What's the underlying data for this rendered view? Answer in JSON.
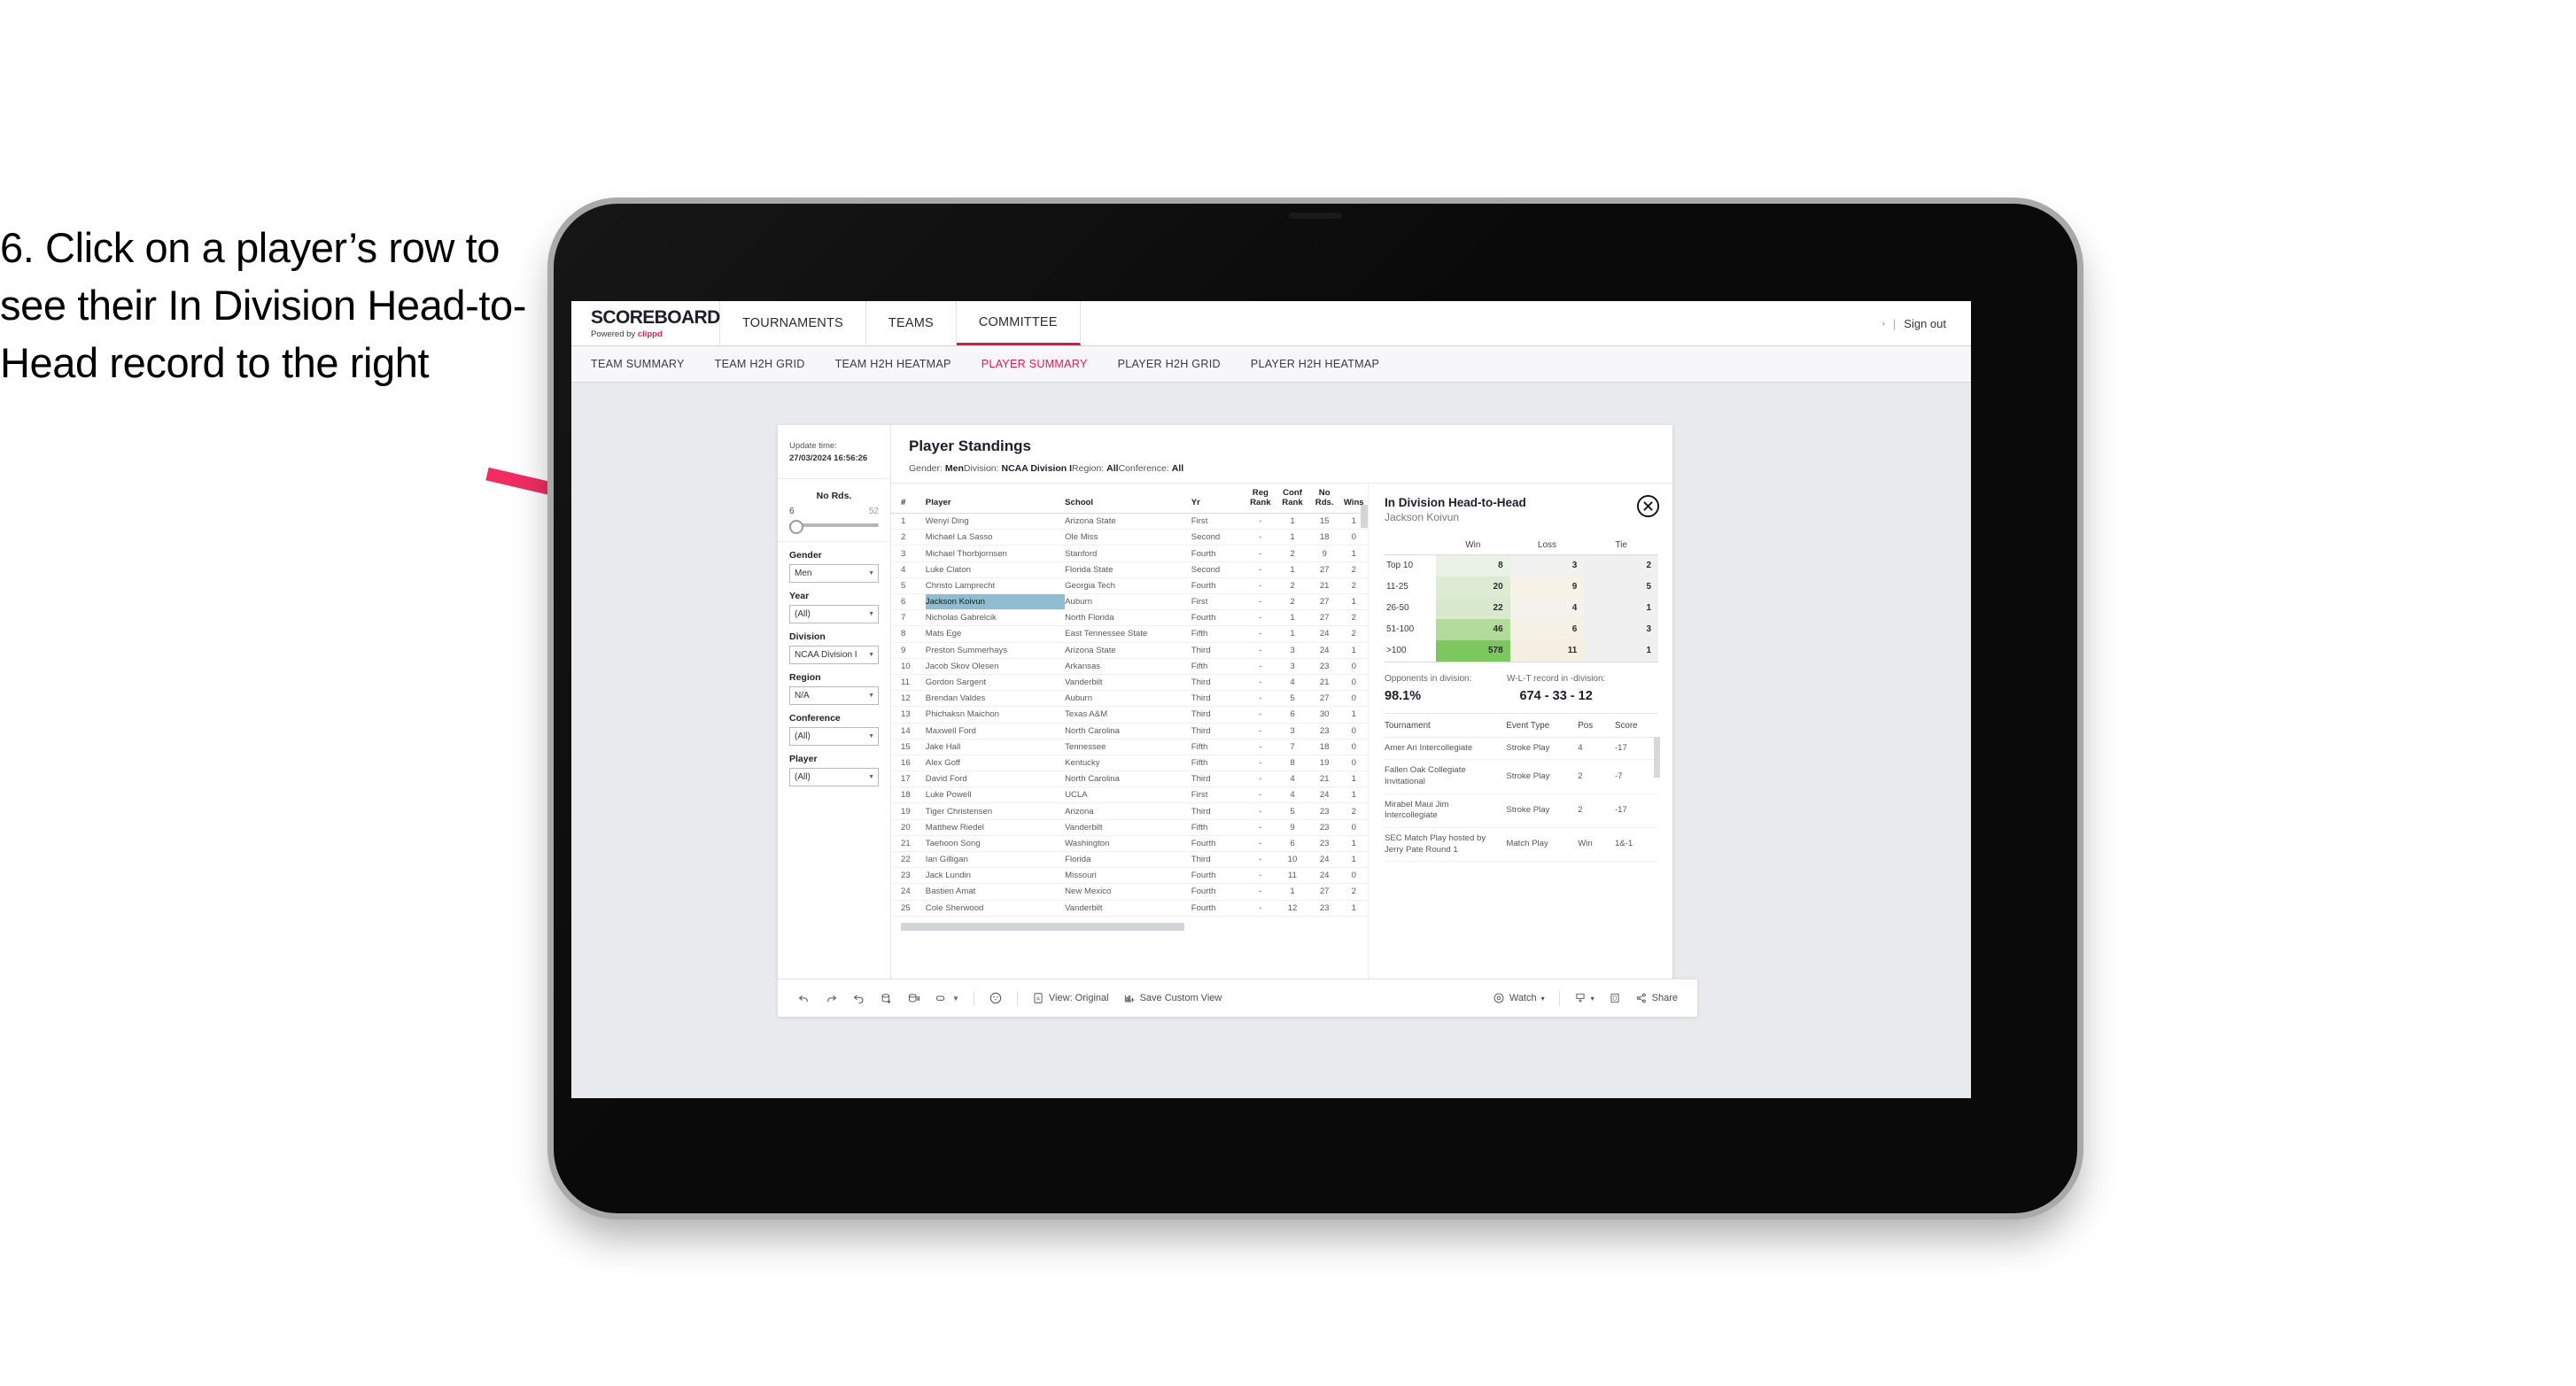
{
  "caption": "6. Click on a player’s row to see their In Division Head-to-Head record to the right",
  "app": {
    "brand_line1": "SCOREBOARD",
    "brand_line2_prefix": "Powered by ",
    "brand_line2_accent": "clippd",
    "accent_color": "#e8174e",
    "nav": [
      {
        "label": "TOURNAMENTS",
        "active": false
      },
      {
        "label": "TEAMS",
        "active": false
      },
      {
        "label": "COMMITTEE",
        "active": true
      }
    ],
    "signout": {
      "caret": "›",
      "separator": "|",
      "label": "Sign out"
    },
    "subtabs": [
      {
        "label": "TEAM SUMMARY",
        "active": false
      },
      {
        "label": "TEAM H2H GRID",
        "active": false
      },
      {
        "label": "TEAM H2H HEATMAP",
        "active": false
      },
      {
        "label": "PLAYER SUMMARY",
        "active": true
      },
      {
        "label": "PLAYER H2H GRID",
        "active": false
      },
      {
        "label": "PLAYER H2H HEATMAP",
        "active": false
      }
    ]
  },
  "rail": {
    "update_label": "Update time:",
    "update_value": "27/03/2024 16:56:26",
    "slider": {
      "label": "No Rds.",
      "min": "6",
      "max": "52"
    },
    "filters": [
      {
        "label": "Gender",
        "value": "Men"
      },
      {
        "label": "Year",
        "value": "(All)"
      },
      {
        "label": "Division",
        "value": "NCAA Division I"
      },
      {
        "label": "Region",
        "value": "N/A"
      },
      {
        "label": "Conference",
        "value": "(All)"
      },
      {
        "label": "Player",
        "value": "(All)"
      }
    ]
  },
  "standings": {
    "title": "Player Standings",
    "filter_summary": [
      {
        "label": "Gender:",
        "value": "Men"
      },
      {
        "label": "Division:",
        "value": "NCAA Division I"
      },
      {
        "label": "Region:",
        "value": "All"
      },
      {
        "label": "Conference:",
        "value": "All"
      }
    ],
    "columns": [
      "#",
      "Player",
      "School",
      "Yr",
      "Reg Rank",
      "Conf Rank",
      "No Rds.",
      "Wins"
    ],
    "rows": [
      {
        "n": "1",
        "player": "Wenyi Ding",
        "school": "Arizona State",
        "yr": "First",
        "reg": "-",
        "conf": "1",
        "rds": "15",
        "wins": "1",
        "selected": false
      },
      {
        "n": "2",
        "player": "Michael La Sasso",
        "school": "Ole Miss",
        "yr": "Second",
        "reg": "-",
        "conf": "1",
        "rds": "18",
        "wins": "0",
        "selected": false
      },
      {
        "n": "3",
        "player": "Michael Thorbjornsen",
        "school": "Stanford",
        "yr": "Fourth",
        "reg": "-",
        "conf": "2",
        "rds": "9",
        "wins": "1",
        "selected": false
      },
      {
        "n": "4",
        "player": "Luke Claton",
        "school": "Florida State",
        "yr": "Second",
        "reg": "-",
        "conf": "1",
        "rds": "27",
        "wins": "2",
        "selected": false
      },
      {
        "n": "5",
        "player": "Christo Lamprecht",
        "school": "Georgia Tech",
        "yr": "Fourth",
        "reg": "-",
        "conf": "2",
        "rds": "21",
        "wins": "2",
        "selected": false
      },
      {
        "n": "6",
        "player": "Jackson Koivun",
        "school": "Auburn",
        "yr": "First",
        "reg": "-",
        "conf": "2",
        "rds": "27",
        "wins": "1",
        "selected": true
      },
      {
        "n": "7",
        "player": "Nicholas Gabrelcik",
        "school": "North Florida",
        "yr": "Fourth",
        "reg": "-",
        "conf": "1",
        "rds": "27",
        "wins": "2",
        "selected": false
      },
      {
        "n": "8",
        "player": "Mats Ege",
        "school": "East Tennessee State",
        "yr": "Fifth",
        "reg": "-",
        "conf": "1",
        "rds": "24",
        "wins": "2",
        "selected": false
      },
      {
        "n": "9",
        "player": "Preston Summerhays",
        "school": "Arizona State",
        "yr": "Third",
        "reg": "-",
        "conf": "3",
        "rds": "24",
        "wins": "1",
        "selected": false
      },
      {
        "n": "10",
        "player": "Jacob Skov Olesen",
        "school": "Arkansas",
        "yr": "Fifth",
        "reg": "-",
        "conf": "3",
        "rds": "23",
        "wins": "0",
        "selected": false
      },
      {
        "n": "11",
        "player": "Gordon Sargent",
        "school": "Vanderbilt",
        "yr": "Third",
        "reg": "-",
        "conf": "4",
        "rds": "21",
        "wins": "0",
        "selected": false
      },
      {
        "n": "12",
        "player": "Brendan Valdes",
        "school": "Auburn",
        "yr": "Third",
        "reg": "-",
        "conf": "5",
        "rds": "27",
        "wins": "0",
        "selected": false
      },
      {
        "n": "13",
        "player": "Phichaksn Maichon",
        "school": "Texas A&M",
        "yr": "Third",
        "reg": "-",
        "conf": "6",
        "rds": "30",
        "wins": "1",
        "selected": false
      },
      {
        "n": "14",
        "player": "Maxwell Ford",
        "school": "North Carolina",
        "yr": "Third",
        "reg": "-",
        "conf": "3",
        "rds": "23",
        "wins": "0",
        "selected": false
      },
      {
        "n": "15",
        "player": "Jake Hall",
        "school": "Tennessee",
        "yr": "Fifth",
        "reg": "-",
        "conf": "7",
        "rds": "18",
        "wins": "0",
        "selected": false
      },
      {
        "n": "16",
        "player": "Alex Goff",
        "school": "Kentucky",
        "yr": "Fifth",
        "reg": "-",
        "conf": "8",
        "rds": "19",
        "wins": "0",
        "selected": false
      },
      {
        "n": "17",
        "player": "David Ford",
        "school": "North Carolina",
        "yr": "Third",
        "reg": "-",
        "conf": "4",
        "rds": "21",
        "wins": "1",
        "selected": false
      },
      {
        "n": "18",
        "player": "Luke Powell",
        "school": "UCLA",
        "yr": "First",
        "reg": "-",
        "conf": "4",
        "rds": "24",
        "wins": "1",
        "selected": false
      },
      {
        "n": "19",
        "player": "Tiger Christensen",
        "school": "Arizona",
        "yr": "Third",
        "reg": "-",
        "conf": "5",
        "rds": "23",
        "wins": "2",
        "selected": false
      },
      {
        "n": "20",
        "player": "Matthew Riedel",
        "school": "Vanderbilt",
        "yr": "Fifth",
        "reg": "-",
        "conf": "9",
        "rds": "23",
        "wins": "0",
        "selected": false
      },
      {
        "n": "21",
        "player": "Taehoon Song",
        "school": "Washington",
        "yr": "Fourth",
        "reg": "-",
        "conf": "6",
        "rds": "23",
        "wins": "1",
        "selected": false
      },
      {
        "n": "22",
        "player": "Ian Gilligan",
        "school": "Florida",
        "yr": "Third",
        "reg": "-",
        "conf": "10",
        "rds": "24",
        "wins": "1",
        "selected": false
      },
      {
        "n": "23",
        "player": "Jack Lundin",
        "school": "Missouri",
        "yr": "Fourth",
        "reg": "-",
        "conf": "11",
        "rds": "24",
        "wins": "0",
        "selected": false
      },
      {
        "n": "24",
        "player": "Bastien Amat",
        "school": "New Mexico",
        "yr": "Fourth",
        "reg": "-",
        "conf": "1",
        "rds": "27",
        "wins": "2",
        "selected": false
      },
      {
        "n": "25",
        "player": "Cole Sherwood",
        "school": "Vanderbilt",
        "yr": "Fourth",
        "reg": "-",
        "conf": "12",
        "rds": "23",
        "wins": "1",
        "selected": false
      }
    ]
  },
  "h2h": {
    "title": "In Division Head-to-Head",
    "player": "Jackson Koivun",
    "close_icon": "close-circle-icon",
    "grid": {
      "columns": [
        "",
        "Win",
        "Loss",
        "Tie"
      ],
      "rows": [
        {
          "band": "Top 10",
          "win": "8",
          "loss": "3",
          "tie": "2",
          "win_bg": "#e9f2e4",
          "loss_bg": "#f1f1ef",
          "tie_bg": "#f0f0f0"
        },
        {
          "band": "11-25",
          "win": "20",
          "loss": "9",
          "tie": "5",
          "win_bg": "#dcebd2",
          "loss_bg": "#f6f2e6",
          "tie_bg": "#f0f0f0"
        },
        {
          "band": "26-50",
          "win": "22",
          "loss": "4",
          "tie": "1",
          "win_bg": "#d9e9cd",
          "loss_bg": "#f4f2ea",
          "tie_bg": "#f0f0f0"
        },
        {
          "band": "51-100",
          "win": "46",
          "loss": "6",
          "tie": "3",
          "win_bg": "#b2dc9a",
          "loss_bg": "#f5f1e4",
          "tie_bg": "#f0f0f0"
        },
        {
          "band": ">100",
          "win": "578",
          "loss": "11",
          "tie": "1",
          "win_bg": "#7cc85f",
          "loss_bg": "#f4efe1",
          "tie_bg": "#f0f0f0"
        }
      ]
    },
    "stats": [
      {
        "label": "Opponents in division:",
        "value": "98.1%"
      },
      {
        "label": "W-L-T record in -division:",
        "value": "674 - 33 - 12"
      }
    ],
    "tournaments": {
      "columns": [
        "Tournament",
        "Event Type",
        "Pos",
        "Score"
      ],
      "rows": [
        {
          "name": "Amer Ari Intercollegiate",
          "event": "Stroke Play",
          "pos": "4",
          "score": "-17"
        },
        {
          "name": "Fallen Oak Collegiate Invitational",
          "event": "Stroke Play",
          "pos": "2",
          "score": "-7"
        },
        {
          "name": "Mirabel Maui Jim Intercollegiate",
          "event": "Stroke Play",
          "pos": "2",
          "score": "-17"
        },
        {
          "name": "SEC Match Play hosted by Jerry Pate Round 1",
          "event": "Match Play",
          "pos": "Win",
          "score": "1&-1"
        }
      ]
    }
  },
  "toolbar": {
    "left_icons": [
      "undo-icon",
      "redo-icon",
      "revert-icon",
      "refresh-data-icon",
      "pause-updates-icon",
      "highlight-icon",
      "dropdown-caret-icon"
    ],
    "alert_icon": "alert-icon",
    "view_icon": "view-icon",
    "view_label": "View: Original",
    "save_icon": "save-custom-view-icon",
    "save_label": "Save Custom View",
    "watch_icon": "watch-icon",
    "watch_label": "Watch",
    "watch_caret": "▾",
    "download_icon": "download-icon",
    "download_caret": "▾",
    "fullscreen_icon": "fullscreen-icon",
    "share_icon": "share-icon",
    "share_label": "Share"
  }
}
